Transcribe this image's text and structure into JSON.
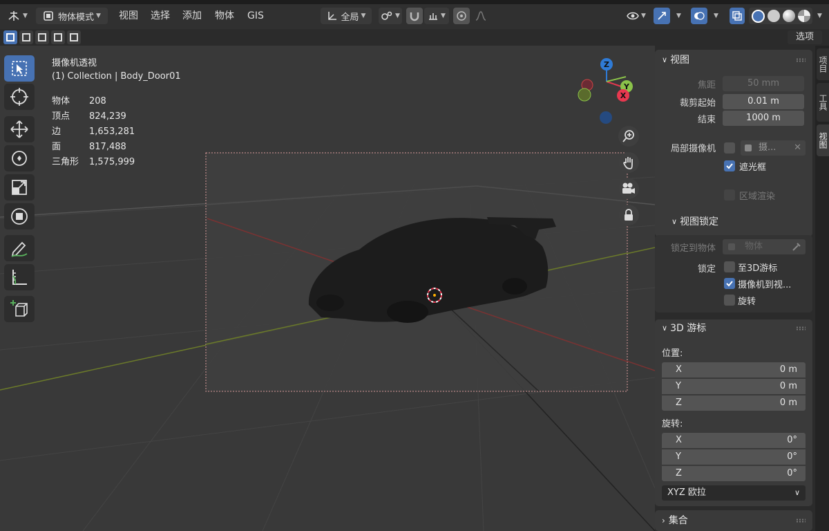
{
  "header": {
    "mode_label": "物体模式",
    "menus": [
      "视图",
      "选择",
      "添加",
      "物体",
      "GIS"
    ],
    "transform_orientation": "全局",
    "options_label": "选项"
  },
  "viewport": {
    "view_name": "摄像机透视",
    "collection_info": "(1) Collection | Body_Door01",
    "stats": [
      {
        "label": "物体",
        "value": "208"
      },
      {
        "label": "顶点",
        "value": "824,239"
      },
      {
        "label": "边",
        "value": "1,653,281"
      },
      {
        "label": "面",
        "value": "817,488"
      },
      {
        "label": "三角形",
        "value": "1,575,999"
      }
    ],
    "gizmo_axes": {
      "z": "Z",
      "y": "Y",
      "x": "X"
    }
  },
  "sidebar": {
    "view_panel": {
      "title": "视图",
      "focal_label": "焦距",
      "focal_value": "50 mm",
      "clip_start_label": "裁剪起始",
      "clip_start_value": "0.01 m",
      "clip_end_label": "结束",
      "clip_end_value": "1000 m",
      "local_camera_label": "局部摄像机",
      "local_camera_value": "摄...",
      "passepartout_label": "遮光框",
      "region_render_label": "区域渲染"
    },
    "view_lock": {
      "title": "视图锁定",
      "lock_to_object_label": "锁定到物体",
      "lock_to_object_placeholder": "物体",
      "lock_label": "锁定",
      "to_cursor_label": "至3D游标",
      "camera_to_view_label": "摄像机到视...",
      "rotation_label": "旋转"
    },
    "cursor_panel": {
      "title": "3D 游标",
      "location_label": "位置:",
      "location": [
        {
          "axis": "X",
          "value": "0 m"
        },
        {
          "axis": "Y",
          "value": "0 m"
        },
        {
          "axis": "Z",
          "value": "0 m"
        }
      ],
      "rotation_label": "旋转:",
      "rotation": [
        {
          "axis": "X",
          "value": "0°"
        },
        {
          "axis": "Y",
          "value": "0°"
        },
        {
          "axis": "Z",
          "value": "0°"
        }
      ],
      "rotation_mode": "XYZ 欧拉"
    },
    "collection_panel": {
      "title": "集合"
    },
    "tabs": [
      "项目",
      "工具",
      "视图"
    ]
  },
  "colors": {
    "accent": "#4772b3",
    "axis_x": "#e8384f",
    "axis_y": "#8bc34a",
    "axis_z": "#2f7bd6"
  }
}
